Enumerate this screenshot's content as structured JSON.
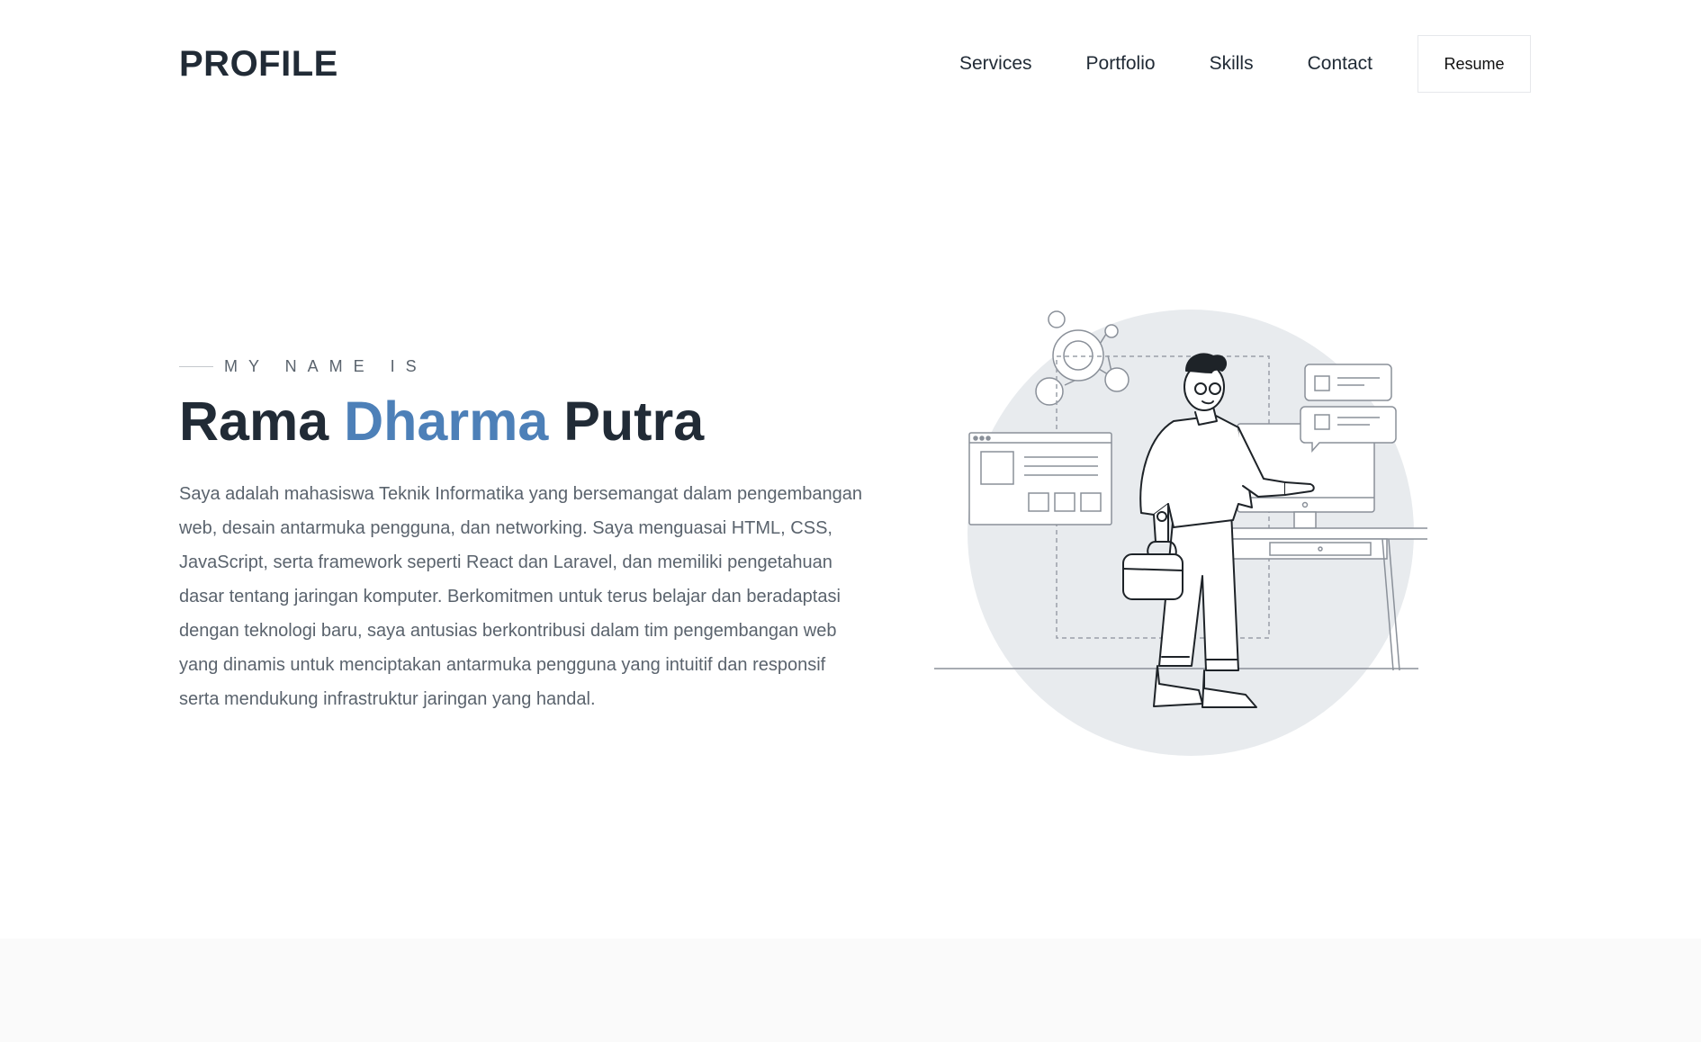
{
  "header": {
    "brand": "PROFILE",
    "nav": [
      "Services",
      "Portfolio",
      "Skills",
      "Contact"
    ],
    "resume_label": "Resume"
  },
  "hero": {
    "eyebrow": "MY NAME IS",
    "name_first": "Rama",
    "name_middle": "Dharma",
    "name_last": "Putra",
    "description": "Saya adalah mahasiswa Teknik Informatika yang bersemangat dalam pengembangan web, desain antarmuka pengguna, dan networking. Saya menguasai HTML, CSS, JavaScript, serta framework seperti React dan Laravel, dan memiliki pengetahuan dasar tentang jaringan komputer. Berkomitmen untuk terus belajar dan beradaptasi dengan teknologi baru, saya antusias berkontribusi dalam tim pengembangan web yang dinamis untuk menciptakan antarmuka pengguna yang intuitif dan responsif serta mendukung infrastruktur jaringan yang handal.",
    "illustration": "developer-at-desk-illustration"
  },
  "colors": {
    "text_dark": "#212b36",
    "text_muted": "#5a636d",
    "accent_blue": "#4d80b8",
    "illustration_circle": "#e8ebee",
    "footer_band": "#fafafa"
  }
}
